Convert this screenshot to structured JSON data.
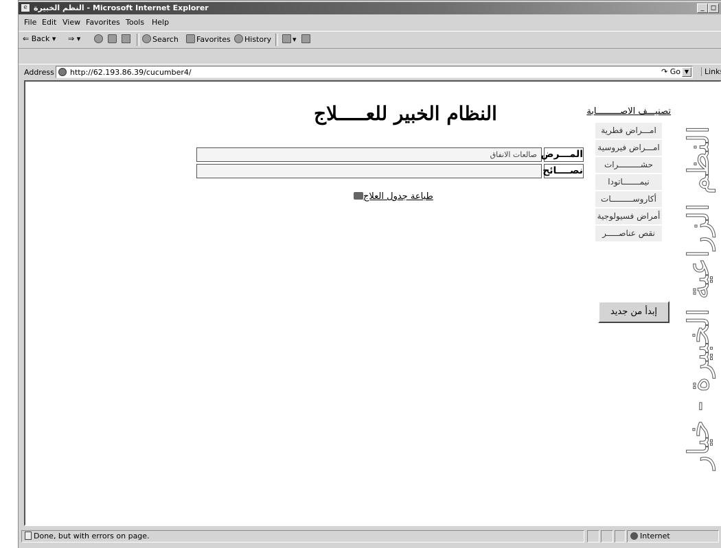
{
  "window": {
    "title": "النظم الخبيرة - Microsoft Internet Explorer",
    "minimize": "_",
    "restore": "◻"
  },
  "menu": [
    "File",
    "Edit",
    "View",
    "Favorites",
    "Tools",
    "Help"
  ],
  "toolbar": {
    "back": "⇐ Back ▾",
    "forward": "⇒ ▾",
    "search": "Search",
    "favorites": "Favorites",
    "history": "History"
  },
  "address": {
    "label": "Address",
    "url": "http://62.193.86.39/cucumber4/",
    "go": "Go",
    "links": "Links"
  },
  "page": {
    "title": "النظام الخبير للعـــــلاج",
    "disease_label": "المـــرض",
    "disease_value": "صالعات الانفاق",
    "advice_label": "نصــــائح",
    "advice_value": "",
    "print_link": "طباعة جدول العلاج",
    "categories_title": "تصنيـــف الاصـــــــــابة",
    "categories": [
      "امـــراض فطرية",
      "امـــراض فيروسية",
      "حشـــــــــرات",
      "نيمـــــــاتودا",
      "أكاروســـــــــات",
      "أمراض فسيولوجية",
      "نقص عناصـــــر"
    ],
    "restart_button": "إبدأ من جديد",
    "side_vertical_text": "النظم الزراعية الخبيرة - خيار"
  },
  "status": {
    "text": "Done, but with errors on page.",
    "zone": "Internet"
  }
}
